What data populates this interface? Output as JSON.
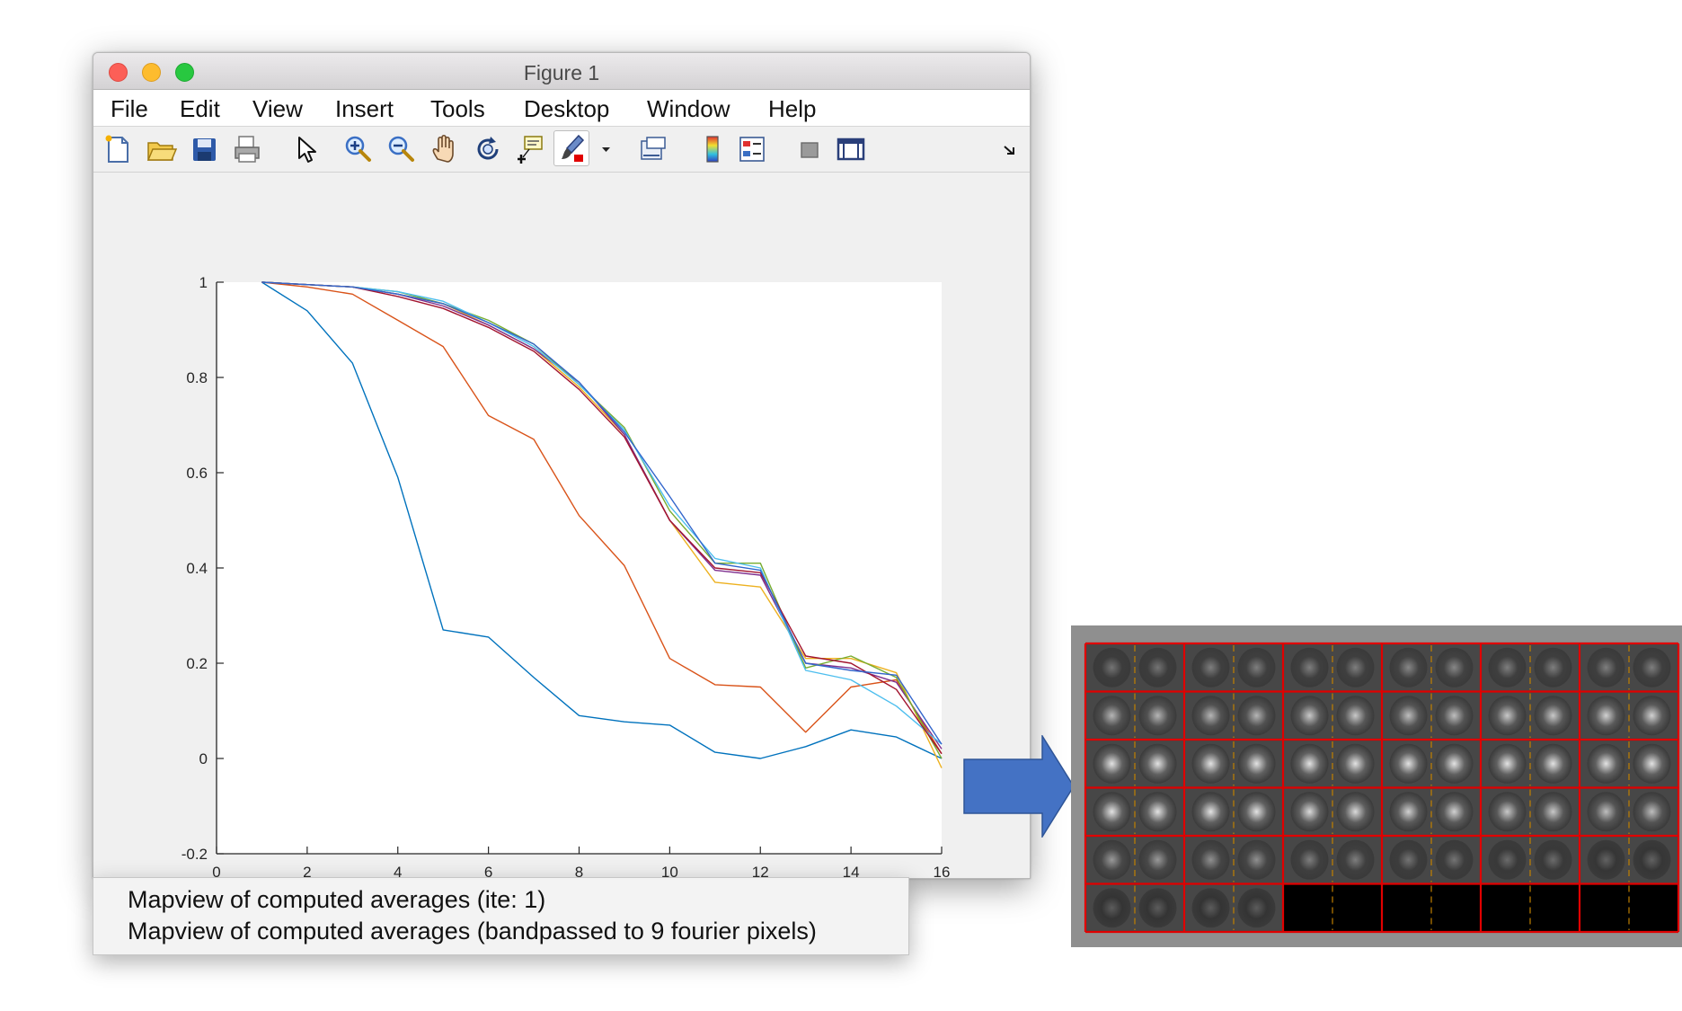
{
  "window": {
    "title": "Figure 1",
    "menu": [
      "File",
      "Edit",
      "View",
      "Insert",
      "Tools",
      "Desktop",
      "Window",
      "Help"
    ],
    "toolbar": [
      "new-figure-icon",
      "open-file-icon",
      "save-icon",
      "print-icon",
      "pointer-icon",
      "zoom-in-icon",
      "zoom-out-icon",
      "pan-hand-icon",
      "rotate-3d-icon",
      "data-cursor-icon",
      "brush-icon",
      "brush-dropdown-icon",
      "link-plot-icon",
      "colorbar-icon",
      "legend-icon",
      "hide-plot-tools-icon",
      "show-plot-tools-icon",
      "dock-icon"
    ]
  },
  "chart_data": {
    "type": "line",
    "xlim": [
      0,
      16
    ],
    "ylim": [
      -0.2,
      1
    ],
    "xticks": [
      "0",
      "2",
      "4",
      "6",
      "8",
      "10",
      "12",
      "14",
      "16"
    ],
    "yticks": [
      "-0.2",
      "0",
      "0.2",
      "0.4",
      "0.6",
      "0.8",
      "1"
    ],
    "grid": false,
    "x": [
      1,
      2,
      3,
      4,
      5,
      6,
      7,
      8,
      9,
      10,
      11,
      12,
      13,
      14,
      15,
      16
    ],
    "series": [
      {
        "color": "#0072BD",
        "values": [
          1.0,
          0.94,
          0.83,
          0.59,
          0.27,
          0.255,
          0.17,
          0.09,
          0.077,
          0.07,
          0.013,
          0.0,
          0.025,
          0.06,
          0.045,
          0.0
        ]
      },
      {
        "color": "#D95319",
        "values": [
          1.0,
          0.99,
          0.975,
          0.92,
          0.865,
          0.72,
          0.67,
          0.51,
          0.405,
          0.21,
          0.155,
          0.15,
          0.055,
          0.15,
          0.165,
          0.01
        ]
      },
      {
        "color": "#EDB120",
        "values": [
          1.0,
          0.995,
          0.99,
          0.975,
          0.955,
          0.91,
          0.86,
          0.78,
          0.68,
          0.5,
          0.37,
          0.36,
          0.21,
          0.21,
          0.18,
          -0.02
        ]
      },
      {
        "color": "#7E2F8E",
        "values": [
          1.0,
          0.995,
          0.99,
          0.975,
          0.95,
          0.91,
          0.86,
          0.79,
          0.68,
          0.5,
          0.395,
          0.385,
          0.2,
          0.19,
          0.16,
          0.02
        ]
      },
      {
        "color": "#77AC30",
        "values": [
          1.0,
          0.995,
          0.99,
          0.98,
          0.955,
          0.92,
          0.87,
          0.785,
          0.695,
          0.52,
          0.41,
          0.41,
          0.19,
          0.215,
          0.17,
          0.0
        ]
      },
      {
        "color": "#4DBEEE",
        "values": [
          1.0,
          0.995,
          0.99,
          0.98,
          0.96,
          0.915,
          0.865,
          0.785,
          0.69,
          0.53,
          0.42,
          0.4,
          0.185,
          0.165,
          0.11,
          0.03
        ]
      },
      {
        "color": "#A2142F",
        "values": [
          1.0,
          0.995,
          0.99,
          0.97,
          0.945,
          0.905,
          0.855,
          0.775,
          0.675,
          0.5,
          0.4,
          0.39,
          0.215,
          0.2,
          0.145,
          0.01
        ]
      },
      {
        "color": "#3366cc",
        "values": [
          1.0,
          0.995,
          0.99,
          0.975,
          0.955,
          0.915,
          0.87,
          0.79,
          0.685,
          0.55,
          0.41,
          0.395,
          0.2,
          0.185,
          0.175,
          0.03
        ]
      }
    ]
  },
  "dropdown": {
    "items": [
      "Mapview of computed averages (ite: 1)",
      "Mapview of computed averages (bandpassed to 9 fourier pixels)"
    ]
  },
  "montage": {
    "columns": 6,
    "rows": 6,
    "intensity_rows": [
      [
        0.25,
        0.3,
        0.3,
        0.35,
        0.3,
        0.3
      ],
      [
        0.6,
        0.6,
        0.7,
        0.65,
        0.7,
        0.75
      ],
      [
        0.85,
        0.85,
        0.85,
        0.85,
        0.85,
        0.85
      ],
      [
        0.85,
        0.85,
        0.8,
        0.75,
        0.7,
        0.65
      ],
      [
        0.45,
        0.4,
        0.3,
        0.25,
        0.2,
        0.15
      ],
      [
        0.12,
        0.12,
        null,
        null,
        null,
        null
      ]
    ],
    "grid_color": "#e00000",
    "divider_color": "#c08000"
  }
}
